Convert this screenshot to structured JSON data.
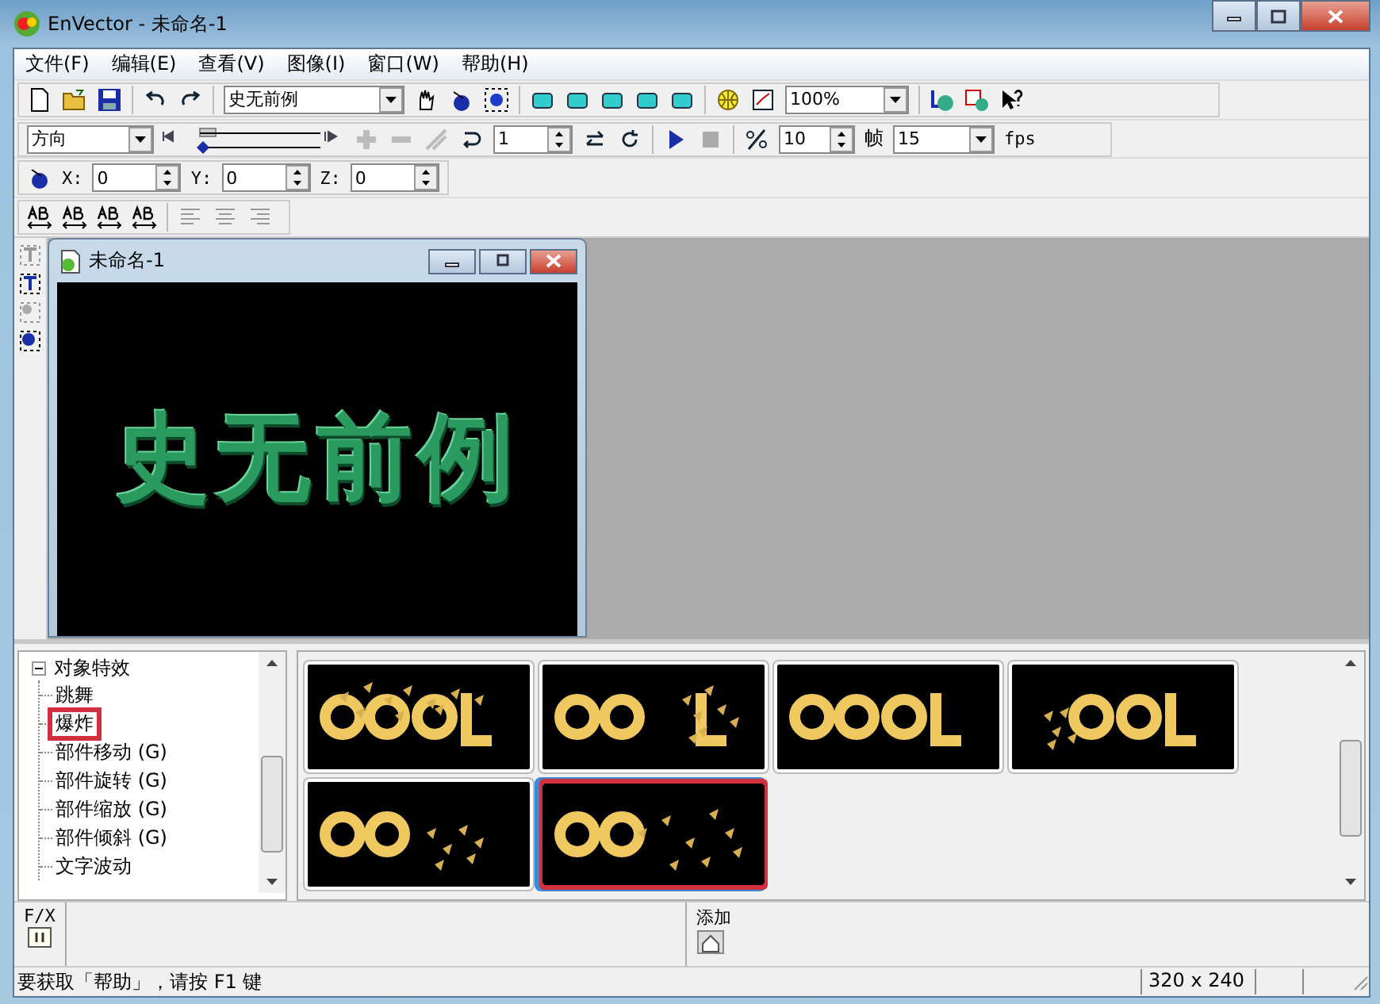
{
  "window": {
    "title": "EnVector - 未命名-1"
  },
  "menu": [
    "文件(F)",
    "编辑(E)",
    "查看(V)",
    "图像(I)",
    "窗口(W)",
    "帮助(H)"
  ],
  "toolbar_main": {
    "font_select": "史无前例",
    "zoom_select": "100%"
  },
  "toolbar_animation": {
    "direction_select": "方向",
    "step_value": "1",
    "frame_value": "10",
    "frame_label": "帧",
    "fps_select": "15",
    "fps_label": "fps"
  },
  "toolbar_position": {
    "x_label": "X:",
    "x_value": "0",
    "y_label": "Y:",
    "y_value": "0",
    "z_label": "Z:",
    "z_value": "0"
  },
  "document": {
    "title": "未命名-1",
    "canvas_text": "史无前例"
  },
  "effects_tree": {
    "root": "对象特效",
    "expanded": true,
    "children": [
      {
        "label": "跳舞",
        "selected": false
      },
      {
        "label": "爆炸",
        "selected": true
      },
      {
        "label": "部件移动 (G)",
        "selected": false
      },
      {
        "label": "部件旋转 (G)",
        "selected": false
      },
      {
        "label": "部件缩放 (G)",
        "selected": false
      },
      {
        "label": "部件倾斜 (G)",
        "selected": false
      },
      {
        "label": "文字波动",
        "selected": false
      }
    ]
  },
  "previews": [
    {
      "selected": false
    },
    {
      "selected": false
    },
    {
      "selected": false
    },
    {
      "selected": false
    },
    {
      "selected": false
    },
    {
      "selected": true
    }
  ],
  "fx_bar": {
    "fx_label": "F/X",
    "add_label": "添加"
  },
  "status_bar": {
    "message": "要获取「帮助」，请按 F1 键",
    "size": "320 x 240"
  }
}
